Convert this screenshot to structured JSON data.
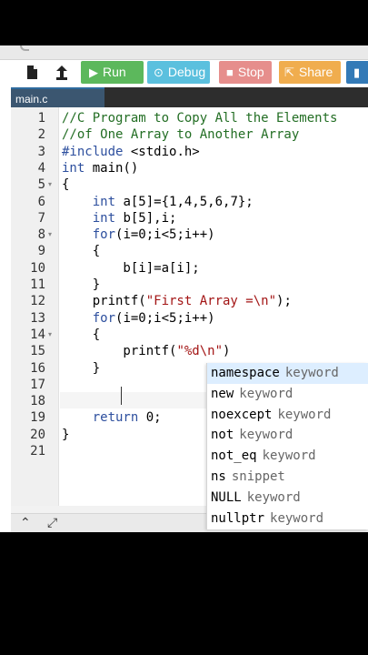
{
  "toolbar": {
    "run_label": "Run",
    "debug_label": "Debug",
    "stop_label": "Stop",
    "share_label": "Share",
    "icons": [
      "file-icon",
      "upload-icon",
      "play-icon",
      "debug-icon",
      "stop-icon",
      "share-icon",
      "save-icon"
    ],
    "colors": {
      "run": "#5cb85c",
      "debug": "#5bc0de",
      "stop": "#d9534f",
      "share": "#f0ad4e"
    }
  },
  "tab": {
    "label": "main.c"
  },
  "editor": {
    "line_numbers": [
      "1",
      "2",
      "3",
      "4",
      "5",
      "6",
      "7",
      "8",
      "9",
      "10",
      "11",
      "12",
      "13",
      "14",
      "15",
      "16",
      "17",
      "18",
      "19",
      "20",
      "21"
    ],
    "lines": [
      "//C Program to Copy All the Elements",
      "//of One Array to Another Array",
      "#include <stdio.h>",
      "int main()",
      "{",
      "    int a[5]={1,4,5,6,7};",
      "    int b[5],i;",
      "    for(i=0;i<5;i++)",
      "    {",
      "        b[i]=a[i];",
      "    }",
      "    printf(\"First Array =\\n\");",
      "    for(i=0;i<5;i++)",
      "    {",
      "        printf(\"%d\\n\")",
      "    }",
      "",
      "",
      "    return 0;",
      "}",
      ""
    ]
  },
  "autocomplete": {
    "items": [
      {
        "name": "namespace",
        "meta": "keyword"
      },
      {
        "name": "new",
        "meta": "keyword"
      },
      {
        "name": "noexcept",
        "meta": "keyword"
      },
      {
        "name": "not",
        "meta": "keyword"
      },
      {
        "name": "not_eq",
        "meta": "keyword"
      },
      {
        "name": "ns",
        "meta": "snippet"
      },
      {
        "name": "NULL",
        "meta": "keyword"
      },
      {
        "name": "nullptr",
        "meta": "keyword"
      }
    ]
  }
}
